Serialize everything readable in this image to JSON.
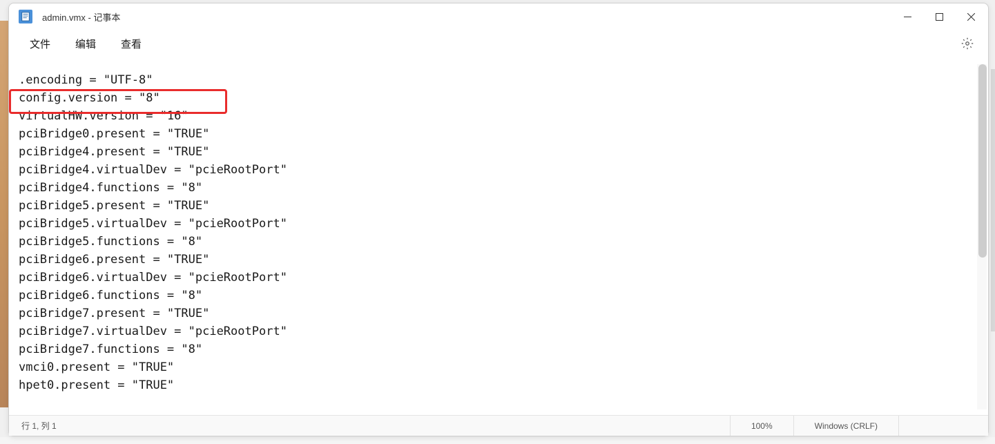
{
  "window": {
    "title": "admin.vmx - 记事本"
  },
  "menubar": {
    "file": "文件",
    "edit": "编辑",
    "view": "查看"
  },
  "content": {
    "lines": [
      ".encoding = \"UTF-8\"",
      "config.version = \"8\"",
      "virtualHW.version = \"16\"",
      "pciBridge0.present = \"TRUE\"",
      "pciBridge4.present = \"TRUE\"",
      "pciBridge4.virtualDev = \"pcieRootPort\"",
      "pciBridge4.functions = \"8\"",
      "pciBridge5.present = \"TRUE\"",
      "pciBridge5.virtualDev = \"pcieRootPort\"",
      "pciBridge5.functions = \"8\"",
      "pciBridge6.present = \"TRUE\"",
      "pciBridge6.virtualDev = \"pcieRootPort\"",
      "pciBridge6.functions = \"8\"",
      "pciBridge7.present = \"TRUE\"",
      "pciBridge7.virtualDev = \"pcieRootPort\"",
      "pciBridge7.functions = \"8\"",
      "vmci0.present = \"TRUE\"",
      "hpet0.present = \"TRUE\""
    ]
  },
  "statusbar": {
    "position": "行 1, 列 1",
    "zoom": "100%",
    "encoding": "Windows (CRLF)"
  }
}
